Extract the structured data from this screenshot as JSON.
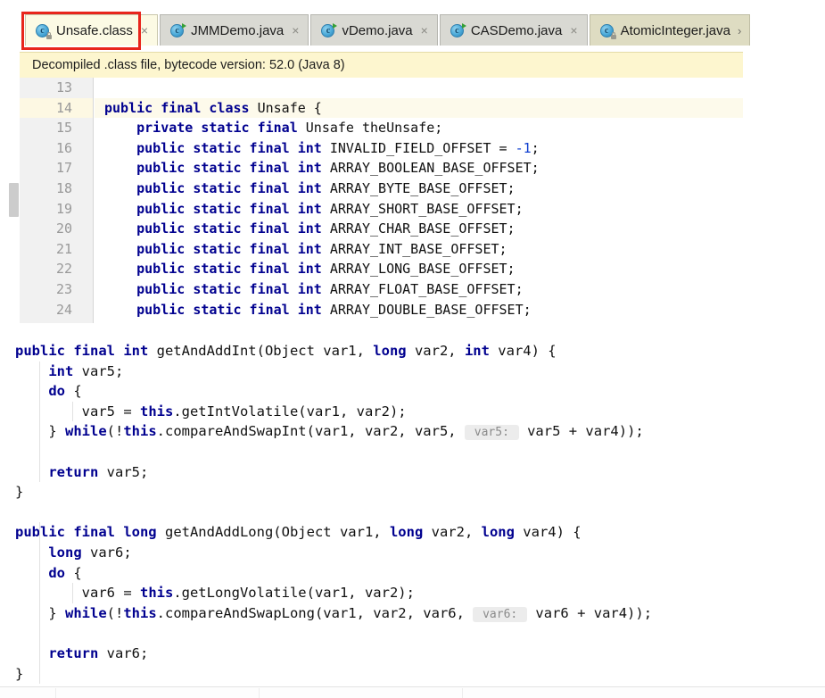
{
  "tabs": [
    {
      "label": "Unsafe.class",
      "icon": "java-class-file-icon",
      "state": "active",
      "closable": true,
      "chevron": false
    },
    {
      "label": "JMMDemo.java",
      "icon": "java-source-file-icon",
      "state": "inactive",
      "closable": true,
      "chevron": false
    },
    {
      "label": "vDemo.java",
      "icon": "java-source-file-icon",
      "state": "inactive",
      "closable": true,
      "chevron": false
    },
    {
      "label": "CASDemo.java",
      "icon": "java-source-file-icon",
      "state": "inactive",
      "closable": true,
      "chevron": false
    },
    {
      "label": "AtomicInteger.java",
      "icon": "java-class-file-icon",
      "state": "readonly",
      "closable": false,
      "chevron": true
    }
  ],
  "tab_close_glyph": "×",
  "tab_chevron_glyph": "›",
  "banner": {
    "text": "Decompiled .class file, bytecode version: 52.0 (Java 8)",
    "background": "#fdf6cf"
  },
  "editor_top": {
    "highlighted_line": 14,
    "lines": [
      {
        "number": "13",
        "segments": []
      },
      {
        "number": "14",
        "segments": [
          {
            "t": "public final class ",
            "c": "kw"
          },
          {
            "t": "Unsafe {",
            "c": "plain"
          }
        ]
      },
      {
        "number": "15",
        "segments": [
          {
            "t": "    private static final ",
            "c": "kw"
          },
          {
            "t": "Unsafe theUnsafe;",
            "c": "plain"
          }
        ]
      },
      {
        "number": "16",
        "segments": [
          {
            "t": "    public static final int ",
            "c": "kw"
          },
          {
            "t": "INVALID_FIELD_OFFSET = ",
            "c": "plain"
          },
          {
            "t": "-1",
            "c": "num"
          },
          {
            "t": ";",
            "c": "plain"
          }
        ]
      },
      {
        "number": "17",
        "segments": [
          {
            "t": "    public static final int ",
            "c": "kw"
          },
          {
            "t": "ARRAY_BOOLEAN_BASE_OFFSET;",
            "c": "plain"
          }
        ]
      },
      {
        "number": "18",
        "segments": [
          {
            "t": "    public static final int ",
            "c": "kw"
          },
          {
            "t": "ARRAY_BYTE_BASE_OFFSET;",
            "c": "plain"
          }
        ]
      },
      {
        "number": "19",
        "segments": [
          {
            "t": "    public static final int ",
            "c": "kw"
          },
          {
            "t": "ARRAY_SHORT_BASE_OFFSET;",
            "c": "plain"
          }
        ]
      },
      {
        "number": "20",
        "segments": [
          {
            "t": "    public static final int ",
            "c": "kw"
          },
          {
            "t": "ARRAY_CHAR_BASE_OFFSET;",
            "c": "plain"
          }
        ]
      },
      {
        "number": "21",
        "segments": [
          {
            "t": "    public static final int ",
            "c": "kw"
          },
          {
            "t": "ARRAY_INT_BASE_OFFSET;",
            "c": "plain"
          }
        ]
      },
      {
        "number": "22",
        "segments": [
          {
            "t": "    public static final int ",
            "c": "kw"
          },
          {
            "t": "ARRAY_LONG_BASE_OFFSET;",
            "c": "plain"
          }
        ]
      },
      {
        "number": "23",
        "segments": [
          {
            "t": "    public static final int ",
            "c": "kw"
          },
          {
            "t": "ARRAY_FLOAT_BASE_OFFSET;",
            "c": "plain"
          }
        ]
      },
      {
        "number": "24",
        "segments": [
          {
            "t": "    public static final int ",
            "c": "kw"
          },
          {
            "t": "ARRAY_DOUBLE_BASE_OFFSET;",
            "c": "plain"
          }
        ]
      }
    ]
  },
  "editor_bottom": {
    "lines": [
      {
        "segments": [
          {
            "t": "public final int ",
            "c": "kw"
          },
          {
            "t": "getAndAddInt(Object var1, ",
            "c": "plain"
          },
          {
            "t": "long ",
            "c": "kw"
          },
          {
            "t": "var2, ",
            "c": "plain"
          },
          {
            "t": "int ",
            "c": "kw"
          },
          {
            "t": "var4) {",
            "c": "plain"
          }
        ]
      },
      {
        "segments": [
          {
            "t": "    int ",
            "c": "kw"
          },
          {
            "t": "var5;",
            "c": "plain"
          }
        ]
      },
      {
        "segments": [
          {
            "t": "    do ",
            "c": "kw"
          },
          {
            "t": "{",
            "c": "plain"
          }
        ]
      },
      {
        "segments": [
          {
            "t": "        var5 = ",
            "c": "plain"
          },
          {
            "t": "this",
            "c": "kw"
          },
          {
            "t": ".getIntVolatile(var1, var2);",
            "c": "plain"
          }
        ]
      },
      {
        "segments": [
          {
            "t": "    } ",
            "c": "plain"
          },
          {
            "t": "while",
            "c": "kw"
          },
          {
            "t": "(!",
            "c": "plain"
          },
          {
            "t": "this",
            "c": "kw"
          },
          {
            "t": ".compareAndSwapInt(var1, var2, var5, ",
            "c": "plain"
          },
          {
            "t": " var5: ",
            "c": "hint"
          },
          {
            "t": " var5 + var4));",
            "c": "plain"
          }
        ]
      },
      {
        "segments": []
      },
      {
        "segments": [
          {
            "t": "    return ",
            "c": "kw"
          },
          {
            "t": "var5;",
            "c": "plain"
          }
        ]
      },
      {
        "segments": [
          {
            "t": "}",
            "c": "plain"
          }
        ]
      },
      {
        "segments": []
      },
      {
        "segments": [
          {
            "t": "public final long ",
            "c": "kw"
          },
          {
            "t": "getAndAddLong(Object var1, ",
            "c": "plain"
          },
          {
            "t": "long ",
            "c": "kw"
          },
          {
            "t": "var2, ",
            "c": "plain"
          },
          {
            "t": "long ",
            "c": "kw"
          },
          {
            "t": "var4) {",
            "c": "plain"
          }
        ]
      },
      {
        "segments": [
          {
            "t": "    long ",
            "c": "kw"
          },
          {
            "t": "var6;",
            "c": "plain"
          }
        ]
      },
      {
        "segments": [
          {
            "t": "    do ",
            "c": "kw"
          },
          {
            "t": "{",
            "c": "plain"
          }
        ]
      },
      {
        "segments": [
          {
            "t": "        var6 = ",
            "c": "plain"
          },
          {
            "t": "this",
            "c": "kw"
          },
          {
            "t": ".getLongVolatile(var1, var2);",
            "c": "plain"
          }
        ]
      },
      {
        "segments": [
          {
            "t": "    } ",
            "c": "plain"
          },
          {
            "t": "while",
            "c": "kw"
          },
          {
            "t": "(!",
            "c": "plain"
          },
          {
            "t": "this",
            "c": "kw"
          },
          {
            "t": ".compareAndSwapLong(var1, var2, var6, ",
            "c": "plain"
          },
          {
            "t": " var6: ",
            "c": "hint"
          },
          {
            "t": " var6 + var4));",
            "c": "plain"
          }
        ]
      },
      {
        "segments": []
      },
      {
        "segments": [
          {
            "t": "    return ",
            "c": "kw"
          },
          {
            "t": "var6;",
            "c": "plain"
          }
        ]
      },
      {
        "segments": [
          {
            "t": "}",
            "c": "plain"
          }
        ]
      }
    ]
  },
  "colors": {
    "keyword": "#00008f",
    "number": "#0f3fcf",
    "identifier": "#111111",
    "banner_bg": "#fdf6cf",
    "active_tab_bg": "#fcfae4",
    "readonly_tab_bg": "#dedcc2",
    "annotation_box": "#e8251c",
    "current_line_hl": "#fdfaeb",
    "gutter_bg": "#f1f1f1",
    "inlay_hint_bg": "#ececec"
  }
}
